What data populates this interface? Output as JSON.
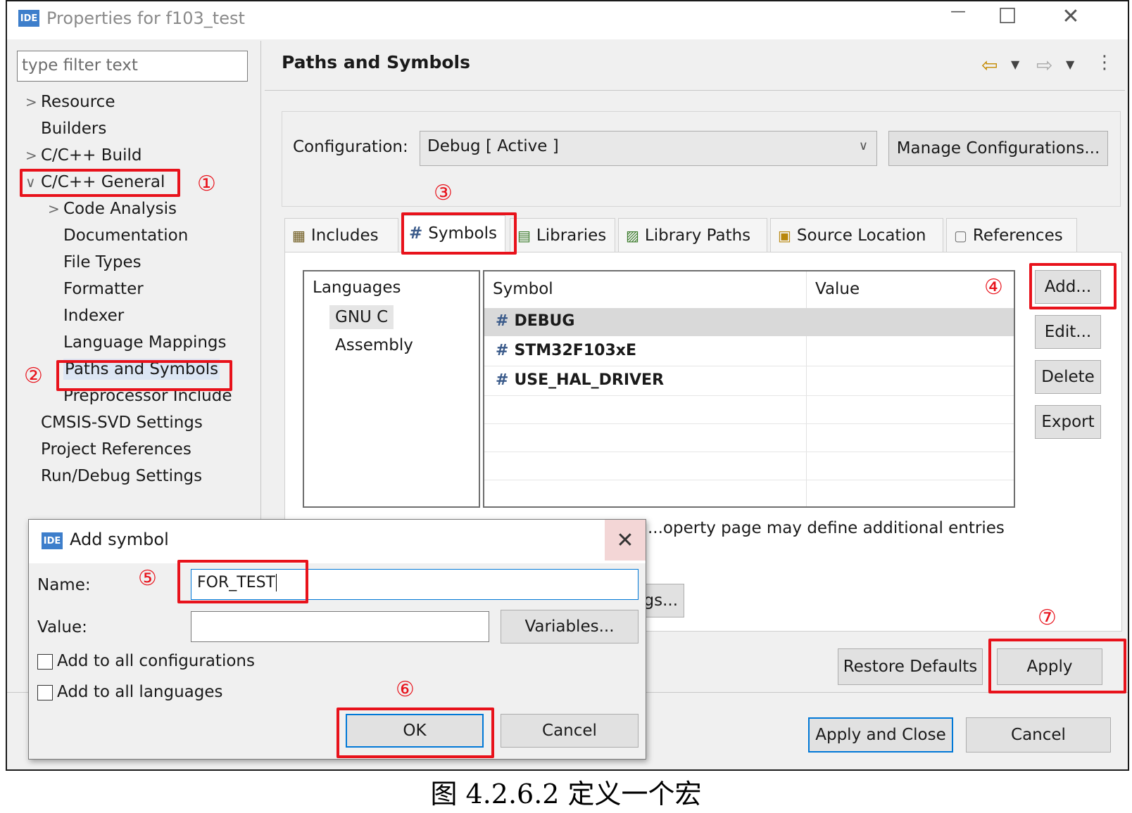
{
  "window": {
    "title": "Properties for f103_test",
    "logo": "IDE",
    "maximize_icon": "☐",
    "close_icon": "✕"
  },
  "sidebar": {
    "filter_placeholder": "type filter text",
    "items": [
      {
        "label": "Resource",
        "arrow": ">"
      },
      {
        "label": "Builders",
        "arrow": ""
      },
      {
        "label": "C/C++ Build",
        "arrow": ">"
      },
      {
        "label": "C/C++ General",
        "arrow": "∨"
      },
      {
        "label": "Code Analysis",
        "arrow": ">"
      },
      {
        "label": "Documentation",
        "arrow": ""
      },
      {
        "label": "File Types",
        "arrow": ""
      },
      {
        "label": "Formatter",
        "arrow": ""
      },
      {
        "label": "Indexer",
        "arrow": ""
      },
      {
        "label": "Language Mappings",
        "arrow": ""
      },
      {
        "label": "Paths and Symbols",
        "arrow": ""
      },
      {
        "label": "Preprocessor Include",
        "arrow": ""
      },
      {
        "label": "CMSIS-SVD Settings",
        "arrow": ""
      },
      {
        "label": "Project References",
        "arrow": ""
      },
      {
        "label": "Run/Debug Settings",
        "arrow": ""
      }
    ]
  },
  "header": {
    "title": "Paths and Symbols"
  },
  "config": {
    "label": "Configuration:",
    "value": "Debug  [ Active ]",
    "manage_button": "Manage Configurations..."
  },
  "tabs": [
    {
      "label": "Includes",
      "icon": "includes-icon"
    },
    {
      "label": "Symbols",
      "icon": "hash-icon"
    },
    {
      "label": "Libraries",
      "icon": "libraries-icon"
    },
    {
      "label": "Library Paths",
      "icon": "library-paths-icon"
    },
    {
      "label": "Source Location",
      "icon": "source-location-icon"
    },
    {
      "label": "References",
      "icon": "references-icon"
    }
  ],
  "languages": {
    "header": "Languages",
    "items": [
      "GNU C",
      "Assembly"
    ],
    "selected": "GNU C"
  },
  "symbols_table": {
    "columns": [
      "Symbol",
      "Value"
    ],
    "rows": [
      {
        "name": "DEBUG",
        "value": ""
      },
      {
        "name": "STM32F103xE",
        "value": ""
      },
      {
        "name": "USE_HAL_DRIVER",
        "value": ""
      }
    ]
  },
  "side_buttons": {
    "add": "Add...",
    "edit": "Edit...",
    "delete": "Delete",
    "export": "Export"
  },
  "note_text": "...operty page may define additional entries",
  "partial_button": "gs...",
  "bottom_buttons": {
    "restore_defaults": "Restore Defaults",
    "apply": "Apply",
    "apply_and_close": "Apply and Close",
    "cancel": "Cancel"
  },
  "dialog": {
    "title": "Add symbol",
    "logo": "IDE",
    "close_icon": "✕",
    "name_label": "Name:",
    "name_value": "FOR_TEST",
    "value_label": "Value:",
    "value_value": "",
    "variables_button": "Variables...",
    "check_all_configs": "Add to all configurations",
    "check_all_languages": "Add to all languages",
    "ok_button": "OK",
    "cancel_button": "Cancel"
  },
  "annotations": {
    "markers": [
      "①",
      "②",
      "③",
      "④",
      "⑤",
      "⑥",
      "⑦"
    ],
    "color": "#e8121b"
  },
  "caption": "图 4.2.6.2 定义一个宏"
}
